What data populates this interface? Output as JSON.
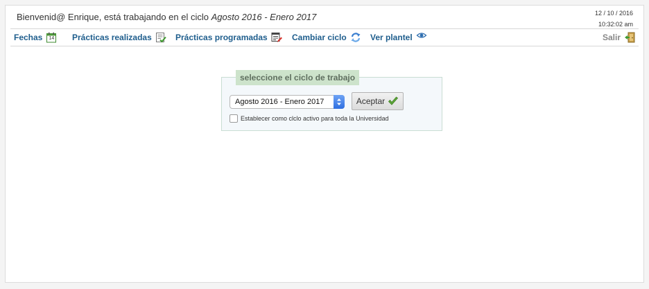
{
  "header": {
    "welcome_prefix": "Bienvenid@ Enrique, está trabajando en el ciclo ",
    "welcome_cycle": "Agosto 2016 - Enero 2017",
    "date": "12 / 10 / 2016",
    "time": "10:32:02 am"
  },
  "nav": {
    "items": [
      {
        "label": "Fechas",
        "icon": "calendar-icon",
        "icon_text": "14"
      },
      {
        "label": "Prácticas realizadas",
        "icon": "checklist-icon"
      },
      {
        "label": "Prácticas programadas",
        "icon": "schedule-edit-icon"
      },
      {
        "label": "Cambiar ciclo",
        "icon": "refresh-icon"
      },
      {
        "label": "Ver plantel",
        "icon": "eye-icon"
      }
    ],
    "logout_label": "Salir",
    "logout_icon": "exit-door-icon"
  },
  "cycle_form": {
    "legend": "seleccione el ciclo de trabajo",
    "selected_cycle": "Agosto 2016 - Enero 2017",
    "accept_label": "Aceptar",
    "accept_icon": "checkmark-icon",
    "checkbox_label": "Establecer como clclo activo para toda la Universidad",
    "checkbox_checked": false
  },
  "colors": {
    "nav_link": "#1f5e8d",
    "legend_bg": "#cde3cb",
    "form_bg": "#f4f8fb",
    "select_accent": "#2f6fe0",
    "check_green": "#5ea93a"
  }
}
